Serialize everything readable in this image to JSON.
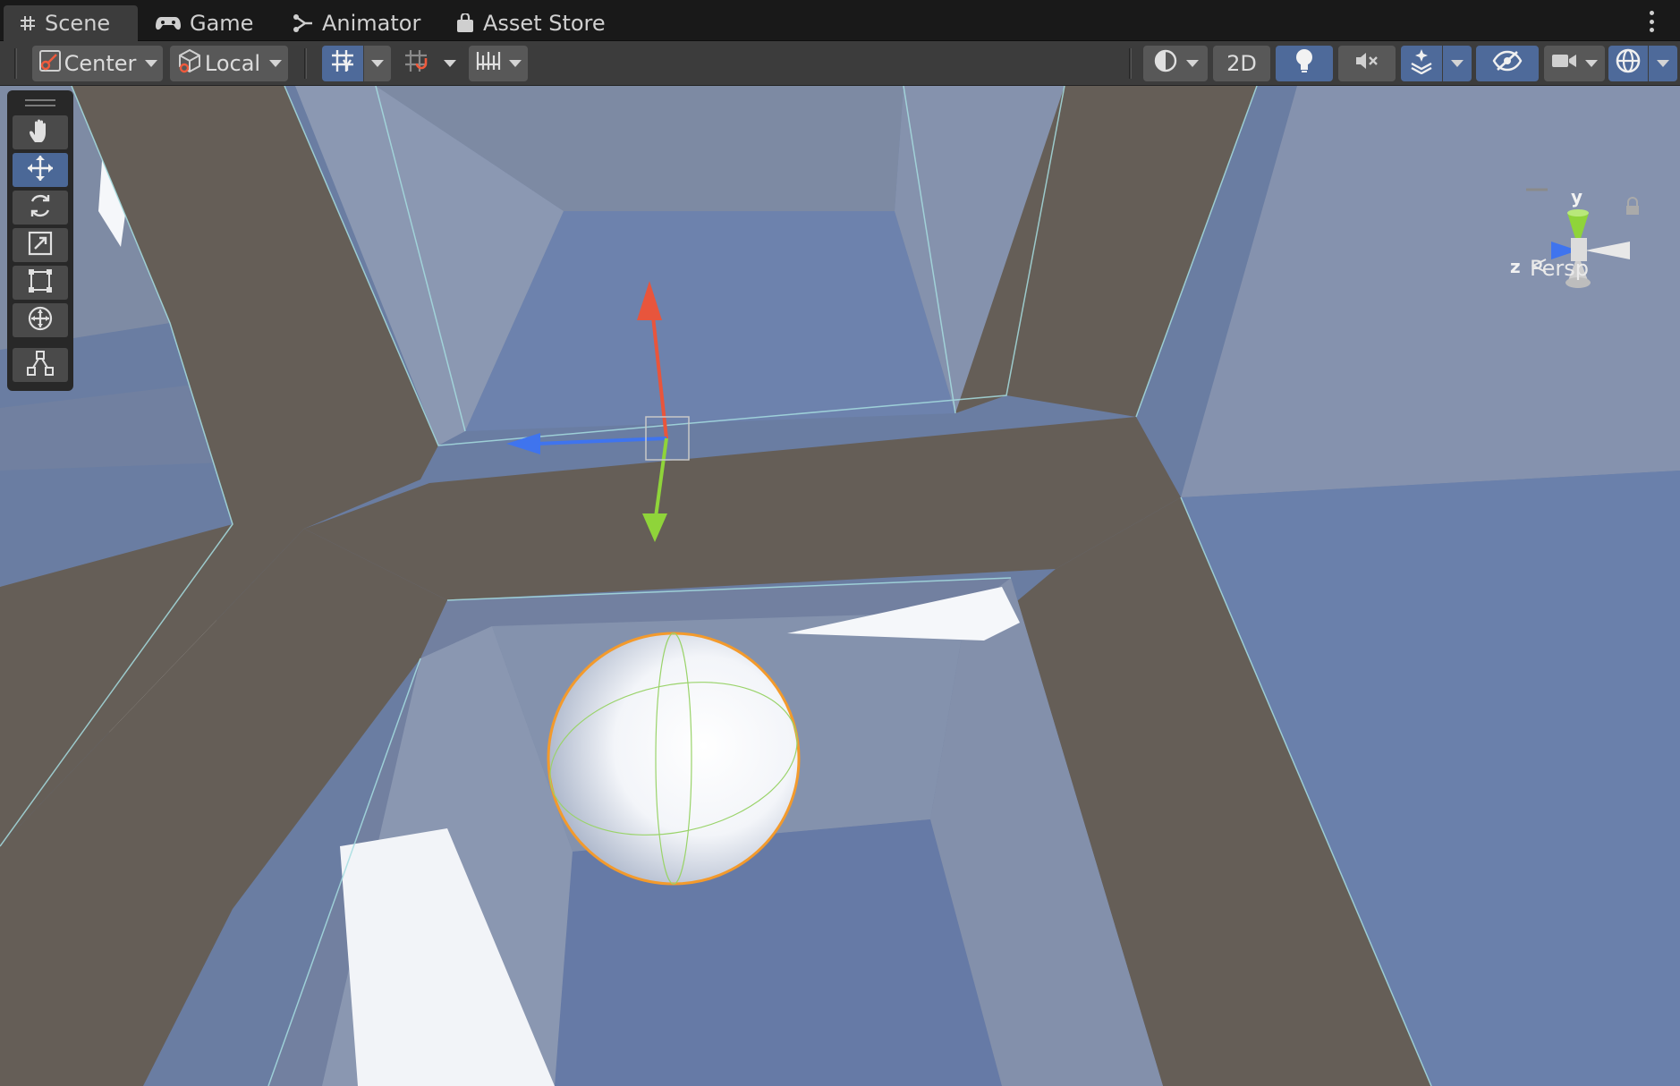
{
  "tabs": [
    {
      "label": "Scene",
      "icon": "hash-icon",
      "active": true
    },
    {
      "label": "Game",
      "icon": "gamepad-icon",
      "active": false
    },
    {
      "label": "Animator",
      "icon": "animator-icon",
      "active": false
    },
    {
      "label": "Asset Store",
      "icon": "bag-icon",
      "active": false
    }
  ],
  "toolbar": {
    "pivot_label": "Center",
    "space_label": "Local",
    "mode_2d_label": "2D"
  },
  "gizmo": {
    "y_label": "y",
    "z_label": "z",
    "projection_label": "Persp"
  },
  "tools": [
    "hand-tool",
    "move-tool",
    "rotate-tool",
    "scale-tool",
    "rect-tool",
    "transform-tool",
    "custom-tool"
  ],
  "colors": {
    "x_axis": "#e8553c",
    "y_axis": "#8fd43a",
    "z_axis": "#3f74ee",
    "selection": "#f39a2c",
    "active_button": "#4e6a9a"
  }
}
